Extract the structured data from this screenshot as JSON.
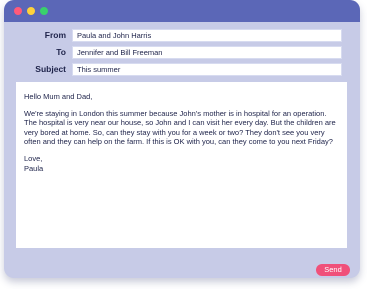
{
  "window": {
    "controls": [
      "close",
      "minimize",
      "maximize"
    ],
    "colors": {
      "titlebar": "#5b67b7",
      "close": "#ff5a7a",
      "minimize": "#ffd23a",
      "maximize": "#39d16c",
      "window_bg": "#c7cbe7",
      "send_button": "#f0507a"
    }
  },
  "header": {
    "from_label": "From",
    "from_value": "Paula and John Harris",
    "to_label": "To",
    "to_value": "Jennifer and Bill Freeman",
    "subject_label": "Subject",
    "subject_value": "This summer"
  },
  "message": {
    "greeting": "Hello Mum and Dad,",
    "paragraph": "We're staying in London this summer because John's mother is in hospital for an operation. The hospital is very near our house, so John and I can visit her every day. But the children are very bored at home. So, can they stay with you for a week or two? They don't see you very often and they can help on the farm. If this is OK with you, can they come to you next Friday?",
    "closing": "Love,",
    "signature": "Paula"
  },
  "actions": {
    "send_label": "Send"
  }
}
